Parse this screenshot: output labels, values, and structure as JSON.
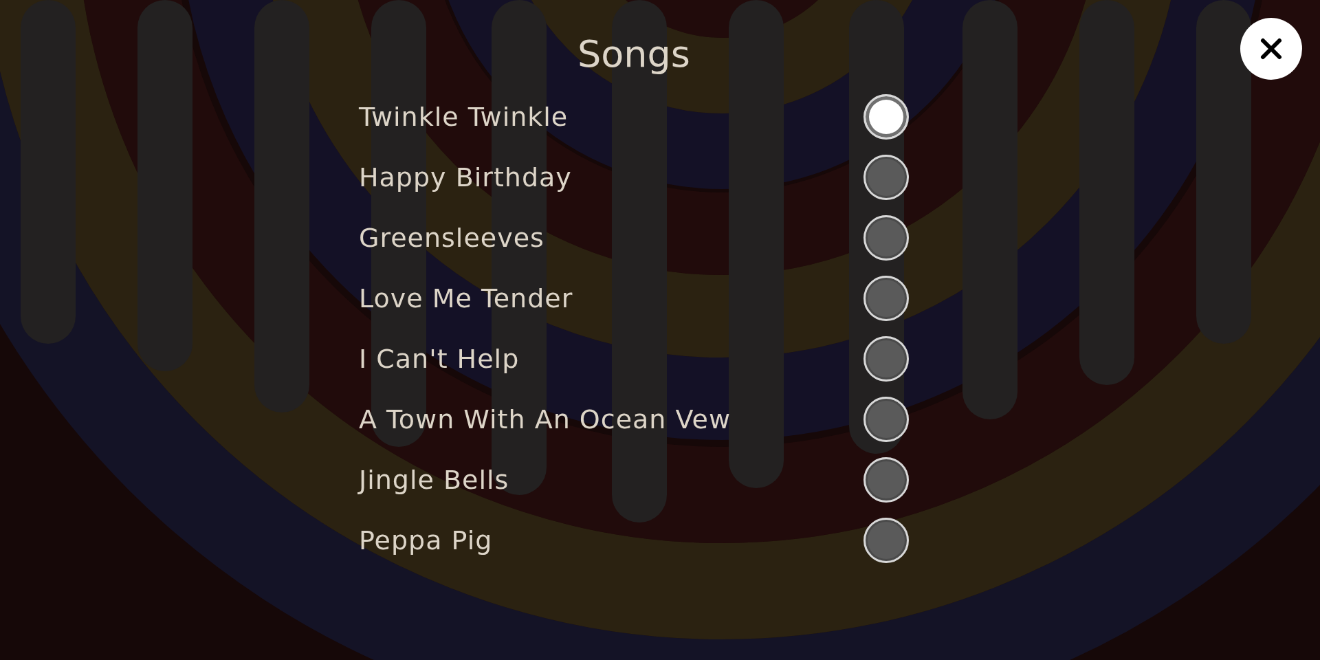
{
  "title": "Songs",
  "songs": [
    {
      "name": "Twinkle Twinkle",
      "selected": true
    },
    {
      "name": "Happy Birthday",
      "selected": false
    },
    {
      "name": "Greensleeves",
      "selected": false
    },
    {
      "name": "Love Me Tender",
      "selected": false
    },
    {
      "name": "I Can't Help",
      "selected": false
    },
    {
      "name": "A Town With An Ocean Vew",
      "selected": false
    },
    {
      "name": "Jingle Bells",
      "selected": false
    },
    {
      "name": "Peppa Pig",
      "selected": false
    }
  ]
}
